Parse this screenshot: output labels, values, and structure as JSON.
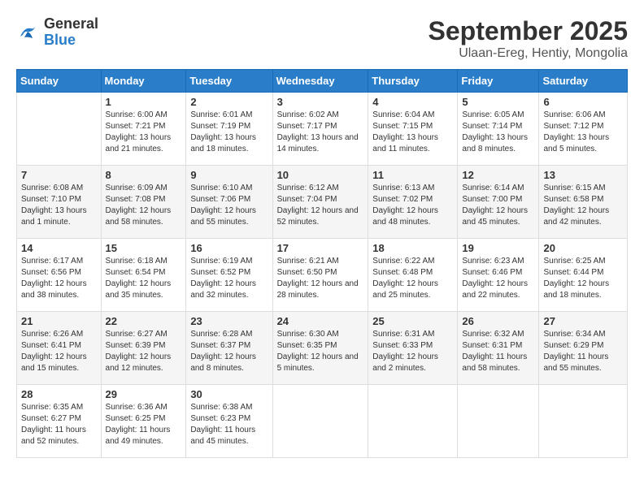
{
  "header": {
    "logo": {
      "general": "General",
      "blue": "Blue"
    },
    "title": "September 2025",
    "location": "Ulaan-Ereg, Hentiy, Mongolia"
  },
  "weekdays": [
    "Sunday",
    "Monday",
    "Tuesday",
    "Wednesday",
    "Thursday",
    "Friday",
    "Saturday"
  ],
  "weeks": [
    [
      {
        "day": "",
        "sunrise": "",
        "sunset": "",
        "daylight": ""
      },
      {
        "day": "1",
        "sunrise": "Sunrise: 6:00 AM",
        "sunset": "Sunset: 7:21 PM",
        "daylight": "Daylight: 13 hours and 21 minutes."
      },
      {
        "day": "2",
        "sunrise": "Sunrise: 6:01 AM",
        "sunset": "Sunset: 7:19 PM",
        "daylight": "Daylight: 13 hours and 18 minutes."
      },
      {
        "day": "3",
        "sunrise": "Sunrise: 6:02 AM",
        "sunset": "Sunset: 7:17 PM",
        "daylight": "Daylight: 13 hours and 14 minutes."
      },
      {
        "day": "4",
        "sunrise": "Sunrise: 6:04 AM",
        "sunset": "Sunset: 7:15 PM",
        "daylight": "Daylight: 13 hours and 11 minutes."
      },
      {
        "day": "5",
        "sunrise": "Sunrise: 6:05 AM",
        "sunset": "Sunset: 7:14 PM",
        "daylight": "Daylight: 13 hours and 8 minutes."
      },
      {
        "day": "6",
        "sunrise": "Sunrise: 6:06 AM",
        "sunset": "Sunset: 7:12 PM",
        "daylight": "Daylight: 13 hours and 5 minutes."
      }
    ],
    [
      {
        "day": "7",
        "sunrise": "Sunrise: 6:08 AM",
        "sunset": "Sunset: 7:10 PM",
        "daylight": "Daylight: 13 hours and 1 minute."
      },
      {
        "day": "8",
        "sunrise": "Sunrise: 6:09 AM",
        "sunset": "Sunset: 7:08 PM",
        "daylight": "Daylight: 12 hours and 58 minutes."
      },
      {
        "day": "9",
        "sunrise": "Sunrise: 6:10 AM",
        "sunset": "Sunset: 7:06 PM",
        "daylight": "Daylight: 12 hours and 55 minutes."
      },
      {
        "day": "10",
        "sunrise": "Sunrise: 6:12 AM",
        "sunset": "Sunset: 7:04 PM",
        "daylight": "Daylight: 12 hours and 52 minutes."
      },
      {
        "day": "11",
        "sunrise": "Sunrise: 6:13 AM",
        "sunset": "Sunset: 7:02 PM",
        "daylight": "Daylight: 12 hours and 48 minutes."
      },
      {
        "day": "12",
        "sunrise": "Sunrise: 6:14 AM",
        "sunset": "Sunset: 7:00 PM",
        "daylight": "Daylight: 12 hours and 45 minutes."
      },
      {
        "day": "13",
        "sunrise": "Sunrise: 6:15 AM",
        "sunset": "Sunset: 6:58 PM",
        "daylight": "Daylight: 12 hours and 42 minutes."
      }
    ],
    [
      {
        "day": "14",
        "sunrise": "Sunrise: 6:17 AM",
        "sunset": "Sunset: 6:56 PM",
        "daylight": "Daylight: 12 hours and 38 minutes."
      },
      {
        "day": "15",
        "sunrise": "Sunrise: 6:18 AM",
        "sunset": "Sunset: 6:54 PM",
        "daylight": "Daylight: 12 hours and 35 minutes."
      },
      {
        "day": "16",
        "sunrise": "Sunrise: 6:19 AM",
        "sunset": "Sunset: 6:52 PM",
        "daylight": "Daylight: 12 hours and 32 minutes."
      },
      {
        "day": "17",
        "sunrise": "Sunrise: 6:21 AM",
        "sunset": "Sunset: 6:50 PM",
        "daylight": "Daylight: 12 hours and 28 minutes."
      },
      {
        "day": "18",
        "sunrise": "Sunrise: 6:22 AM",
        "sunset": "Sunset: 6:48 PM",
        "daylight": "Daylight: 12 hours and 25 minutes."
      },
      {
        "day": "19",
        "sunrise": "Sunrise: 6:23 AM",
        "sunset": "Sunset: 6:46 PM",
        "daylight": "Daylight: 12 hours and 22 minutes."
      },
      {
        "day": "20",
        "sunrise": "Sunrise: 6:25 AM",
        "sunset": "Sunset: 6:44 PM",
        "daylight": "Daylight: 12 hours and 18 minutes."
      }
    ],
    [
      {
        "day": "21",
        "sunrise": "Sunrise: 6:26 AM",
        "sunset": "Sunset: 6:41 PM",
        "daylight": "Daylight: 12 hours and 15 minutes."
      },
      {
        "day": "22",
        "sunrise": "Sunrise: 6:27 AM",
        "sunset": "Sunset: 6:39 PM",
        "daylight": "Daylight: 12 hours and 12 minutes."
      },
      {
        "day": "23",
        "sunrise": "Sunrise: 6:28 AM",
        "sunset": "Sunset: 6:37 PM",
        "daylight": "Daylight: 12 hours and 8 minutes."
      },
      {
        "day": "24",
        "sunrise": "Sunrise: 6:30 AM",
        "sunset": "Sunset: 6:35 PM",
        "daylight": "Daylight: 12 hours and 5 minutes."
      },
      {
        "day": "25",
        "sunrise": "Sunrise: 6:31 AM",
        "sunset": "Sunset: 6:33 PM",
        "daylight": "Daylight: 12 hours and 2 minutes."
      },
      {
        "day": "26",
        "sunrise": "Sunrise: 6:32 AM",
        "sunset": "Sunset: 6:31 PM",
        "daylight": "Daylight: 11 hours and 58 minutes."
      },
      {
        "day": "27",
        "sunrise": "Sunrise: 6:34 AM",
        "sunset": "Sunset: 6:29 PM",
        "daylight": "Daylight: 11 hours and 55 minutes."
      }
    ],
    [
      {
        "day": "28",
        "sunrise": "Sunrise: 6:35 AM",
        "sunset": "Sunset: 6:27 PM",
        "daylight": "Daylight: 11 hours and 52 minutes."
      },
      {
        "day": "29",
        "sunrise": "Sunrise: 6:36 AM",
        "sunset": "Sunset: 6:25 PM",
        "daylight": "Daylight: 11 hours and 49 minutes."
      },
      {
        "day": "30",
        "sunrise": "Sunrise: 6:38 AM",
        "sunset": "Sunset: 6:23 PM",
        "daylight": "Daylight: 11 hours and 45 minutes."
      },
      {
        "day": "",
        "sunrise": "",
        "sunset": "",
        "daylight": ""
      },
      {
        "day": "",
        "sunrise": "",
        "sunset": "",
        "daylight": ""
      },
      {
        "day": "",
        "sunrise": "",
        "sunset": "",
        "daylight": ""
      },
      {
        "day": "",
        "sunrise": "",
        "sunset": "",
        "daylight": ""
      }
    ]
  ]
}
